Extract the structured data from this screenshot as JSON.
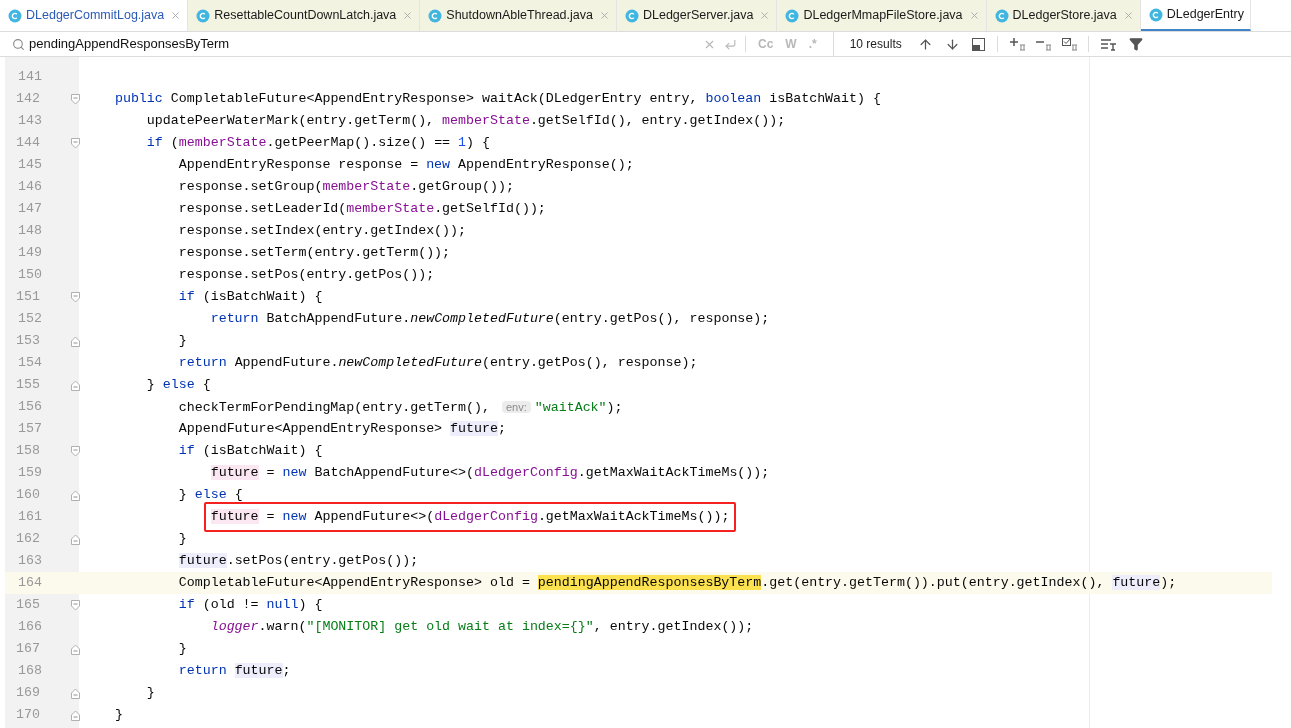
{
  "tabs": [
    {
      "label": "DLedgerCommitLog.java",
      "selected": false,
      "modified": true,
      "library": false
    },
    {
      "label": "ResettableCountDownLatch.java",
      "selected": false,
      "modified": false,
      "library": true
    },
    {
      "label": "ShutdownAbleThread.java",
      "selected": false,
      "modified": false,
      "library": true
    },
    {
      "label": "DLedgerServer.java",
      "selected": false,
      "modified": false,
      "library": true
    },
    {
      "label": "DLedgerMmapFileStore.java",
      "selected": false,
      "modified": false,
      "library": true
    },
    {
      "label": "DLedgerStore.java",
      "selected": false,
      "modified": false,
      "library": true
    },
    {
      "label": "DLedgerEntry",
      "selected": true,
      "modified": false,
      "library": false
    }
  ],
  "search": {
    "value": "pendingAppendResponsesByTerm",
    "options": [
      {
        "label": "Cc",
        "on": false
      },
      {
        "label": "W",
        "on": false
      },
      {
        "label": ".*",
        "on": false
      }
    ],
    "results": "10 results"
  },
  "lines": [
    {
      "number": "141",
      "current": false
    },
    {
      "number": "142",
      "current": false,
      "fold": {
        "kind": "start"
      },
      "tokens": [
        {
          "kind": "kw",
          "t": "    public"
        },
        {
          "kind": "p",
          "t": " CompletableFuture<AppendEntryResponse> waitAck(DLedgerEntry entry, "
        },
        {
          "kind": "kw",
          "t": "boolean"
        },
        {
          "kind": "p",
          "t": " isBatchWait) {"
        }
      ]
    },
    {
      "number": "143",
      "current": false,
      "tokens": [
        {
          "kind": "p",
          "t": "        updatePeerWaterMark(entry.getTerm(), "
        },
        {
          "kind": "f",
          "t": "memberState"
        },
        {
          "kind": "p",
          "t": ".getSelfId(), entry.getIndex());"
        }
      ]
    },
    {
      "number": "144",
      "current": false,
      "fold": {
        "kind": "start"
      },
      "tokens": [
        {
          "kind": "kw",
          "t": "        if"
        },
        {
          "kind": "p",
          "t": " ("
        },
        {
          "kind": "f",
          "t": "memberState"
        },
        {
          "kind": "p",
          "t": ".getPeerMap().size() == "
        },
        {
          "kind": "num",
          "t": "1"
        },
        {
          "kind": "p",
          "t": ") {"
        }
      ]
    },
    {
      "number": "145",
      "current": false,
      "tokens": [
        {
          "kind": "p",
          "t": "            AppendEntryResponse response = "
        },
        {
          "kind": "kw",
          "t": "new"
        },
        {
          "kind": "p",
          "t": " AppendEntryResponse();"
        }
      ]
    },
    {
      "number": "146",
      "current": false,
      "tokens": [
        {
          "kind": "p",
          "t": "            response.setGroup("
        },
        {
          "kind": "f",
          "t": "memberState"
        },
        {
          "kind": "p",
          "t": ".getGroup());"
        }
      ]
    },
    {
      "number": "147",
      "current": false,
      "tokens": [
        {
          "kind": "p",
          "t": "            response.setLeaderId("
        },
        {
          "kind": "f",
          "t": "memberState"
        },
        {
          "kind": "p",
          "t": ".getSelfId());"
        }
      ]
    },
    {
      "number": "148",
      "current": false,
      "tokens": [
        {
          "kind": "p",
          "t": "            response.setIndex(entry.getIndex());"
        }
      ]
    },
    {
      "number": "149",
      "current": false,
      "tokens": [
        {
          "kind": "p",
          "t": "            response.setTerm(entry.getTerm());"
        }
      ]
    },
    {
      "number": "150",
      "current": false,
      "tokens": [
        {
          "kind": "p",
          "t": "            response.setPos(entry.getPos());"
        }
      ]
    },
    {
      "number": "151",
      "current": false,
      "fold": {
        "kind": "start"
      },
      "tokens": [
        {
          "kind": "kw",
          "t": "            if"
        },
        {
          "kind": "p",
          "t": " (isBatchWait) {"
        }
      ]
    },
    {
      "number": "152",
      "current": false,
      "tokens": [
        {
          "kind": "kw",
          "t": "                return"
        },
        {
          "kind": "p",
          "t": " BatchAppendFuture."
        },
        {
          "kind": "st",
          "t": "newCompletedFuture"
        },
        {
          "kind": "p",
          "t": "(entry.getPos(), response);"
        }
      ]
    },
    {
      "number": "153",
      "current": false,
      "fold": {
        "kind": "end"
      },
      "tokens": [
        {
          "kind": "p",
          "t": "            }"
        }
      ]
    },
    {
      "number": "154",
      "current": false,
      "tokens": [
        {
          "kind": "kw",
          "t": "            return"
        },
        {
          "kind": "p",
          "t": " AppendFuture."
        },
        {
          "kind": "st",
          "t": "newCompletedFuture"
        },
        {
          "kind": "p",
          "t": "(entry.getPos(), response);"
        }
      ]
    },
    {
      "number": "155",
      "current": false,
      "fold": {
        "kind": "end"
      },
      "tokens": [
        {
          "kind": "p",
          "t": "        } "
        },
        {
          "kind": "kw",
          "t": "else"
        },
        {
          "kind": "p",
          "t": " {"
        }
      ]
    },
    {
      "number": "156",
      "current": false,
      "tokens": [
        {
          "kind": "p",
          "t": "            checkTermForPendingMap(entry.getTerm(), "
        },
        {
          "kind": "hint",
          "t": "env:"
        },
        {
          "kind": "str",
          "t": "\"waitAck\""
        },
        {
          "kind": "p",
          "t": ");"
        }
      ]
    },
    {
      "number": "157",
      "current": false,
      "tokens": [
        {
          "kind": "p",
          "t": "            AppendFuture<AppendEntryResponse> "
        },
        {
          "kind": "read",
          "t": "future"
        },
        {
          "kind": "p",
          "t": ";"
        }
      ]
    },
    {
      "number": "158",
      "current": false,
      "fold": {
        "kind": "start"
      },
      "tokens": [
        {
          "kind": "kw",
          "t": "            if"
        },
        {
          "kind": "p",
          "t": " (isBatchWait) {"
        }
      ]
    },
    {
      "number": "159",
      "current": false,
      "tokens": [
        {
          "kind": "write",
          "t": "                future"
        },
        {
          "kind": "p",
          "t": " = "
        },
        {
          "kind": "kw",
          "t": "new"
        },
        {
          "kind": "p",
          "t": " BatchAppendFuture<>("
        },
        {
          "kind": "f",
          "t": "dLedgerConfig"
        },
        {
          "kind": "p",
          "t": ".getMaxWaitAckTimeMs());"
        }
      ]
    },
    {
      "number": "160",
      "current": false,
      "fold": {
        "kind": "end"
      },
      "tokens": [
        {
          "kind": "p",
          "t": "            } "
        },
        {
          "kind": "kw",
          "t": "else"
        },
        {
          "kind": "p",
          "t": " {"
        }
      ]
    },
    {
      "number": "161",
      "current": false,
      "framed": true,
      "tokens": [
        {
          "kind": "write",
          "t": "                future"
        },
        {
          "kind": "p",
          "t": " = "
        },
        {
          "kind": "kw",
          "t": "new"
        },
        {
          "kind": "p",
          "t": " AppendFuture<>("
        },
        {
          "kind": "f",
          "t": "dLedgerConfig"
        },
        {
          "kind": "p",
          "t": ".getMaxWaitAckTimeMs());"
        }
      ]
    },
    {
      "number": "162",
      "current": false,
      "fold": {
        "kind": "end"
      },
      "tokens": [
        {
          "kind": "p",
          "t": "            }"
        }
      ]
    },
    {
      "number": "163",
      "current": false,
      "tokens": [
        {
          "kind": "read",
          "t": "            future"
        },
        {
          "kind": "p",
          "t": ".setPos(entry.getPos());"
        }
      ]
    },
    {
      "number": "164",
      "current": true,
      "tokens": [
        {
          "kind": "p",
          "t": "            CompletableFuture<AppendEntryResponse> old = "
        },
        {
          "kind": "match",
          "t": "pendingAppendResponsesByTerm"
        },
        {
          "kind": "p",
          "t": ".get(entry.getTerm()).put(entry.getIndex(), "
        },
        {
          "kind": "read",
          "t": "future"
        },
        {
          "kind": "p",
          "t": ");"
        }
      ]
    },
    {
      "number": "165",
      "current": false,
      "fold": {
        "kind": "start"
      },
      "tokens": [
        {
          "kind": "kw",
          "t": "            if"
        },
        {
          "kind": "p",
          "t": " (old != "
        },
        {
          "kind": "kw",
          "t": "null"
        },
        {
          "kind": "p",
          "t": ") {"
        }
      ]
    },
    {
      "number": "166",
      "current": false,
      "tokens": [
        {
          "kind": "sf",
          "t": "                logger"
        },
        {
          "kind": "p",
          "t": ".warn("
        },
        {
          "kind": "str",
          "t": "\"[MONITOR] get old wait at index={}\""
        },
        {
          "kind": "p",
          "t": ", entry.getIndex());"
        }
      ]
    },
    {
      "number": "167",
      "current": false,
      "fold": {
        "kind": "end"
      },
      "tokens": [
        {
          "kind": "p",
          "t": "            }"
        }
      ]
    },
    {
      "number": "168",
      "current": false,
      "tokens": [
        {
          "kind": "kw",
          "t": "            return"
        },
        {
          "kind": "read",
          "t": " future"
        },
        {
          "kind": "p",
          "t": ";"
        }
      ]
    },
    {
      "number": "169",
      "current": false,
      "fold": {
        "kind": "end"
      },
      "tokens": [
        {
          "kind": "p",
          "t": "        }"
        }
      ]
    },
    {
      "number": "170",
      "current": false,
      "fold": {
        "kind": "end"
      },
      "tokens": [
        {
          "kind": "p",
          "t": "    }"
        }
      ]
    }
  ]
}
